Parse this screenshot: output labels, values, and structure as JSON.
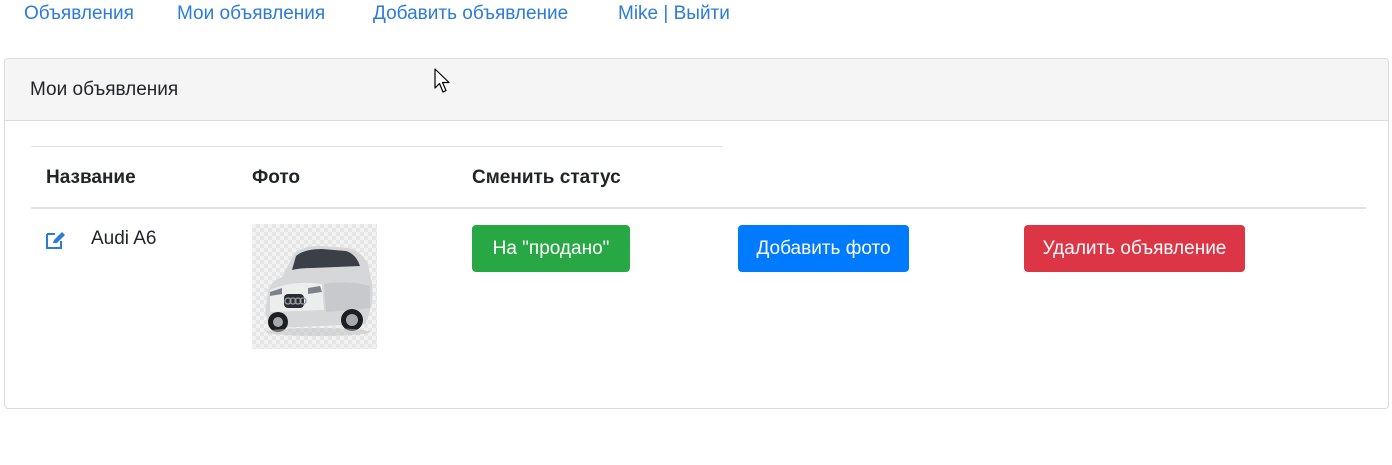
{
  "nav": {
    "items": [
      "Объявления",
      "Мои объявления",
      "Добавить объявление",
      "Mike | Выйти"
    ]
  },
  "card": {
    "title": "Мои объявления"
  },
  "table": {
    "headers": [
      "Название",
      "Фото",
      "Сменить статус"
    ],
    "rows": [
      {
        "name": "Audi A6",
        "photo_icon": "car-photo",
        "buttons": {
          "status": "На \"продано\"",
          "add_photo": "Добавить фото",
          "delete": "Удалить объявление"
        }
      }
    ]
  },
  "colors": {
    "link": "#2b7bd8",
    "success": "#28a745",
    "primary": "#007bff",
    "danger": "#dc3545",
    "header_bg": "#f5f5f5"
  },
  "icons": {
    "edit": "edit-icon",
    "cursor": "mouse-cursor-icon"
  }
}
